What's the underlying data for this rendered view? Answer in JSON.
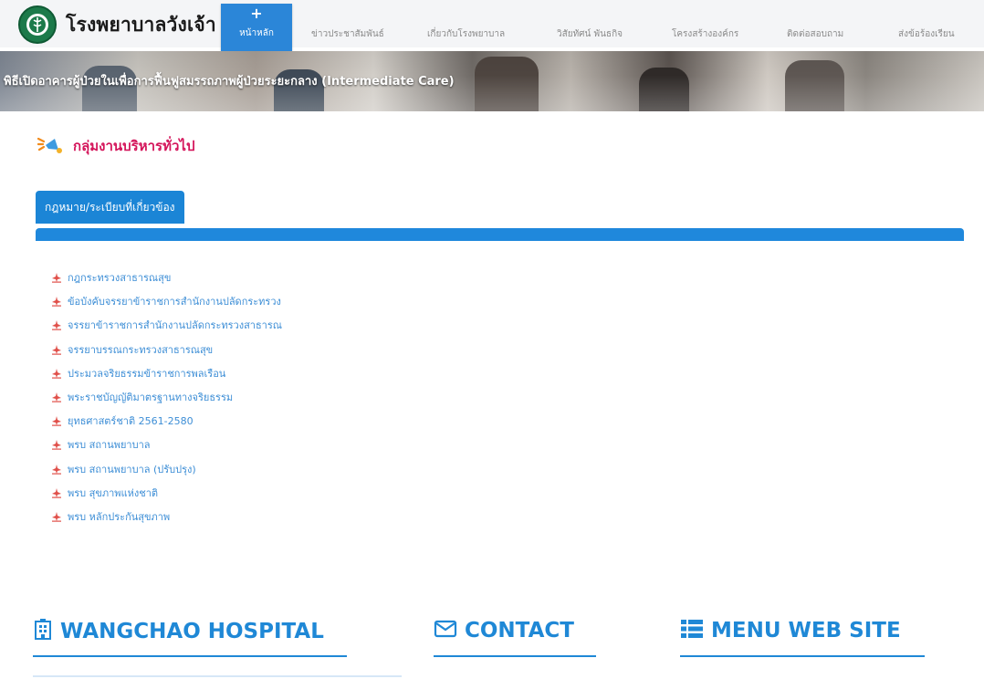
{
  "site": {
    "name": "โรงพยาบาลวังเจ้า"
  },
  "nav": {
    "home_label": "หน้าหลัก",
    "items": [
      "ข่าวประชาสัมพันธ์",
      "เกี่ยวกับโรงพยาบาล",
      "วิสัยทัศน์ พันธกิจ",
      "โครงสร้างองค์กร",
      "ติดต่อสอบถาม",
      "ส่งข้อร้องเรียน"
    ]
  },
  "banner": {
    "text": "พิธีเปิดอาคารผู้ป่วยในเพื่อการฟื้นฟูสมรรถภาพผู้ป่วยระยะกลาง (Intermediate Care)"
  },
  "section": {
    "title": "กลุ่มงานบริหารทั่วไป"
  },
  "category": {
    "tab_label": "กฎหมาย/ระเบียบที่เกี่ยวข้อง"
  },
  "documents": [
    "กฎกระทรวงสาธารณสุข",
    "ข้อบังคับจรรยาข้าราชการสำนักงานปลัดกระทรวง",
    "จรรยาข้าราชการสำนักงานปลัดกระทรวงสาธารณ",
    "จรรยาบรรณกระทรวงสาธารณสุข",
    "ประมวลจริยธรรมข้าราชการพลเรือน",
    "พระราชบัญญัติมาตรฐานทางจริยธรรม",
    "ยุทธศาสตร์ชาติ 2561-2580",
    "พรบ สถานพยาบาล",
    "พรบ สถานพยาบาล (ปรับปรุง)",
    "พรบ สุขภาพแห่งชาติ",
    "พรบ หลักประกันสุขภาพ"
  ],
  "footer": {
    "hospital": "WANGCHAO HOSPITAL",
    "contact": "CONTACT",
    "menu": "MENU WEB SITE"
  },
  "colors": {
    "accent": "#1f88d6",
    "section_title": "#d4145a",
    "link": "#3d8ed6",
    "pdf_icon": "#e0504a"
  }
}
